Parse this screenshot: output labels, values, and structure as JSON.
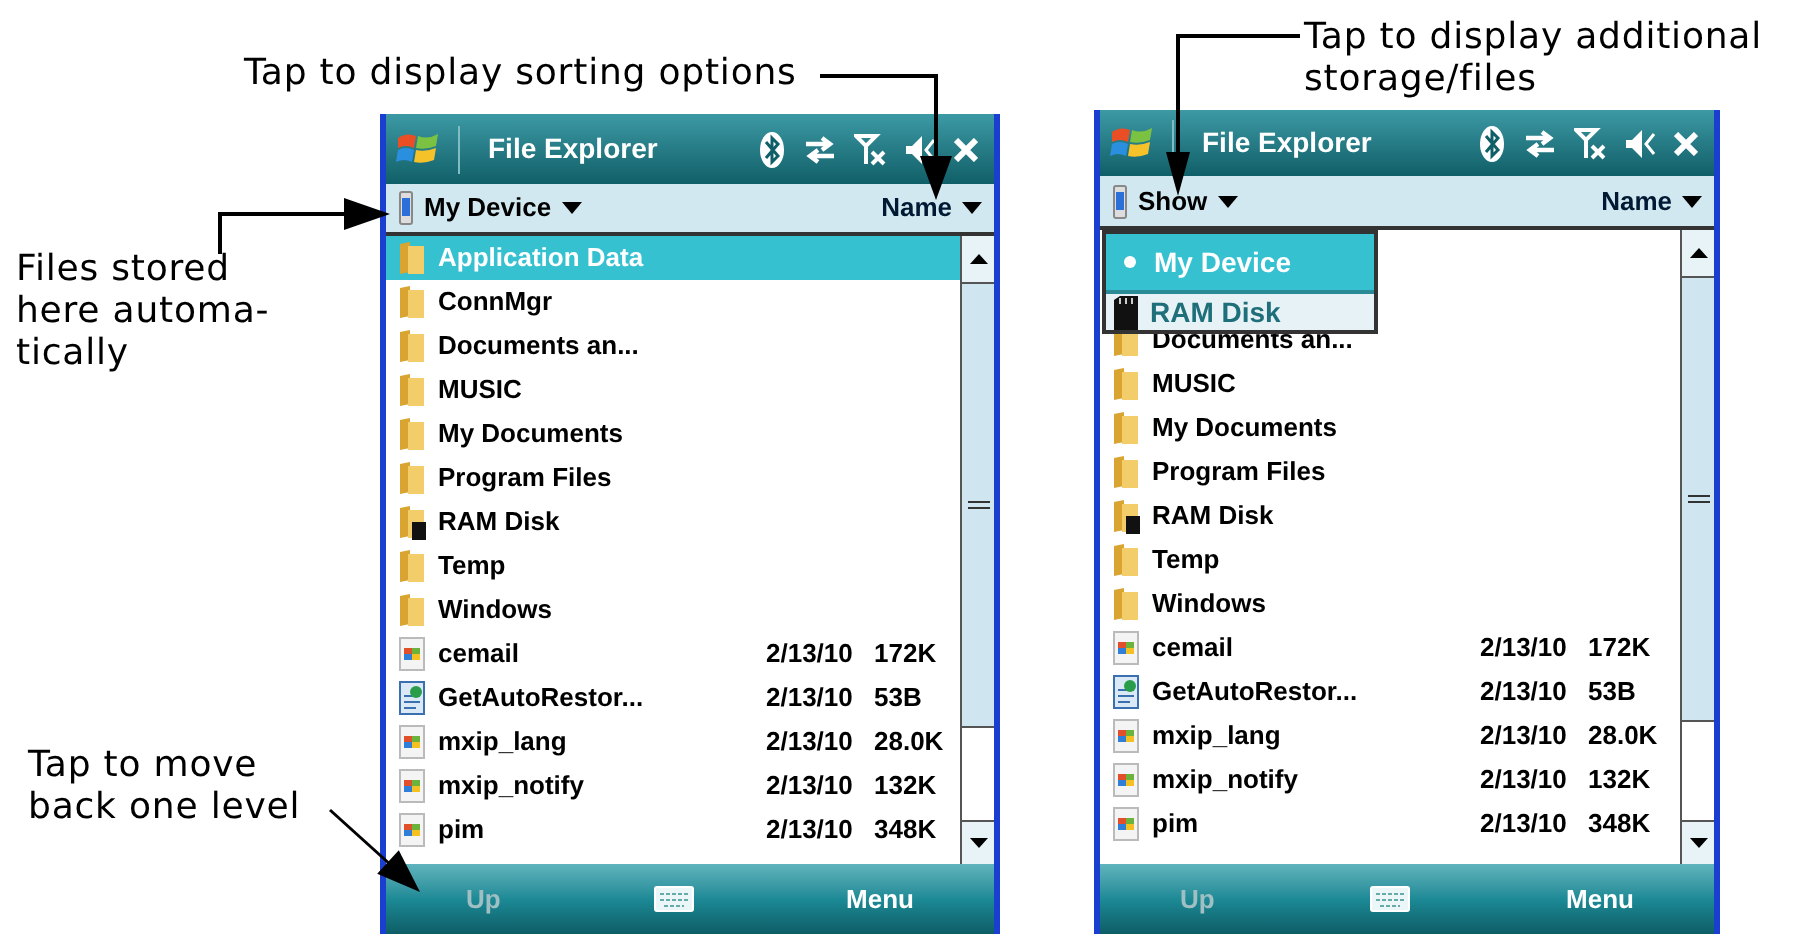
{
  "annotations": [
    {
      "text": "Tap to display sorting options"
    },
    {
      "text": "Files stored\nhere automa-\ntically"
    },
    {
      "text": "Tap to move\nback one level"
    },
    {
      "text": "Tap to display additional\nstorage/files"
    }
  ],
  "screens": [
    {
      "title": "File Explorer",
      "location": "My Device",
      "sort": "Name",
      "rows": [
        {
          "kind": "folder",
          "name": "Application Data",
          "selected": true
        },
        {
          "kind": "folder",
          "name": "ConnMgr",
          "selected": false
        },
        {
          "kind": "folder",
          "name": "Documents an...",
          "selected": false
        },
        {
          "kind": "folder",
          "name": "MUSIC",
          "selected": false
        },
        {
          "kind": "folder",
          "name": "My Documents",
          "selected": false
        },
        {
          "kind": "folder",
          "name": "Program Files",
          "selected": false
        },
        {
          "kind": "storage",
          "name": "RAM Disk",
          "selected": false
        },
        {
          "kind": "folder",
          "name": "Temp",
          "selected": false
        },
        {
          "kind": "folder",
          "name": "Windows",
          "selected": false
        },
        {
          "kind": "app",
          "name": "cemail",
          "date": "2/13/10",
          "size": "172K",
          "selected": false
        },
        {
          "kind": "script",
          "name": "GetAutoRestor...",
          "date": "2/13/10",
          "size": "53B",
          "selected": false
        },
        {
          "kind": "app",
          "name": "mxip_lang",
          "date": "2/13/10",
          "size": "28.0K",
          "selected": false
        },
        {
          "kind": "app",
          "name": "mxip_notify",
          "date": "2/13/10",
          "size": "132K",
          "selected": false
        },
        {
          "kind": "app",
          "name": "pim",
          "date": "2/13/10",
          "size": "348K",
          "selected": false
        }
      ],
      "bottom_bar": {
        "left": "Up",
        "left_disabled": true,
        "right": "Menu"
      }
    },
    {
      "title": "File Explorer",
      "location": "Show",
      "sort": "Name",
      "dropdown": [
        {
          "label": "My Device",
          "selected": true,
          "kind": "device"
        },
        {
          "label": "RAM Disk",
          "selected": false,
          "kind": "card"
        }
      ],
      "rows": [
        {
          "kind": "folder",
          "name": "Documents an...",
          "selected": false
        },
        {
          "kind": "folder",
          "name": "MUSIC",
          "selected": false
        },
        {
          "kind": "folder",
          "name": "My Documents",
          "selected": false
        },
        {
          "kind": "folder",
          "name": "Program Files",
          "selected": false
        },
        {
          "kind": "storage",
          "name": "RAM Disk",
          "selected": false
        },
        {
          "kind": "folder",
          "name": "Temp",
          "selected": false
        },
        {
          "kind": "folder",
          "name": "Windows",
          "selected": false
        },
        {
          "kind": "app",
          "name": "cemail",
          "date": "2/13/10",
          "size": "172K",
          "selected": false
        },
        {
          "kind": "script",
          "name": "GetAutoRestor...",
          "date": "2/13/10",
          "size": "53B",
          "selected": false
        },
        {
          "kind": "app",
          "name": "mxip_lang",
          "date": "2/13/10",
          "size": "28.0K",
          "selected": false
        },
        {
          "kind": "app",
          "name": "mxip_notify",
          "date": "2/13/10",
          "size": "132K",
          "selected": false
        },
        {
          "kind": "app",
          "name": "pim",
          "date": "2/13/10",
          "size": "348K",
          "selected": false
        }
      ],
      "bottom_bar": {
        "left": "Up",
        "left_disabled": true,
        "right": "Menu"
      }
    }
  ]
}
